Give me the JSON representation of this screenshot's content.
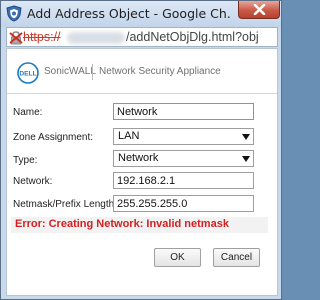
{
  "window": {
    "title": "Add Address Object - Google Ch...",
    "url_scheme": "https://",
    "url_path": "/addNetObjDlg.html?obj"
  },
  "brand": {
    "logo_text": "DELL",
    "name": "SonicWALL",
    "product": "Network Security Appliance"
  },
  "form": {
    "name_label": "Name:",
    "name_value": "Network",
    "zone_label": "Zone Assignment:",
    "zone_value": "LAN",
    "type_label": "Type:",
    "type_value": "Network",
    "network_label": "Network:",
    "network_value": "192.168.2.1",
    "netmask_label": "Netmask/Prefix Length:",
    "netmask_value": "255.255.255.0"
  },
  "error": {
    "message": "Error: Creating Network: Invalid netmask"
  },
  "buttons": {
    "ok": "OK",
    "cancel": "Cancel"
  },
  "icons": {
    "app": "shield-app-icon",
    "close": "close-icon",
    "lock": "broken-lock-icon",
    "dropdown": "chevron-down-icon"
  },
  "colors": {
    "error": "#d42020",
    "close_button": "#c75a48",
    "titlebar": "#c9d9ec"
  }
}
